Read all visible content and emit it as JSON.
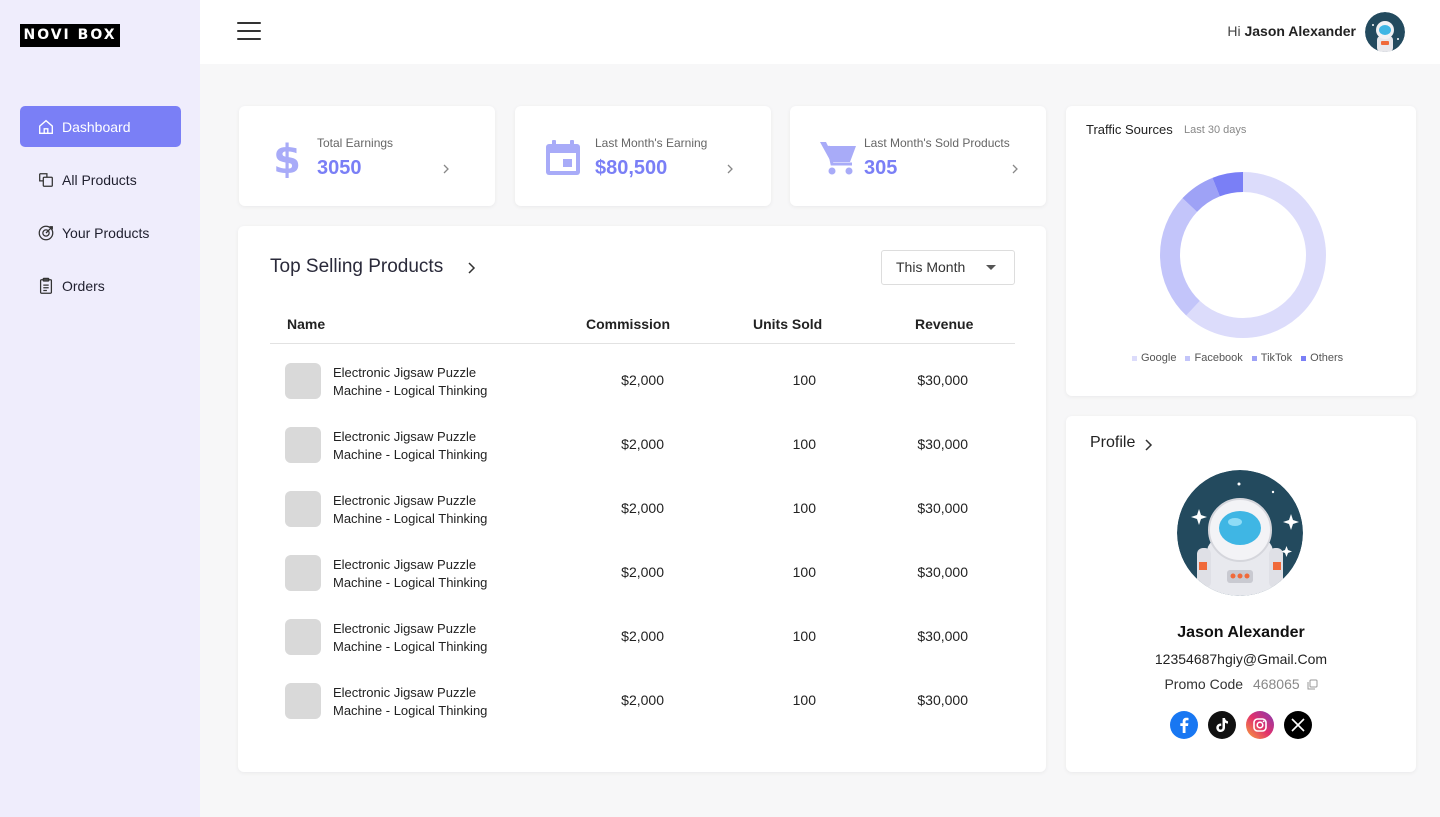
{
  "brand": {
    "logo_text": "NOVI BOX"
  },
  "sidebar": {
    "items": [
      {
        "label": "Dashboard",
        "icon": "home-icon",
        "active": true
      },
      {
        "label": "All Products",
        "icon": "products-icon"
      },
      {
        "label": "Your Products",
        "icon": "target-icon"
      },
      {
        "label": "Orders",
        "icon": "clipboard-icon"
      }
    ]
  },
  "header": {
    "greeting_prefix": "Hi",
    "user_name": "Jason Alexander"
  },
  "stats": [
    {
      "label": "Total Earnings",
      "value": "3050",
      "icon": "dollar-icon"
    },
    {
      "label": "Last Month's Earning",
      "value": "$80,500",
      "icon": "calendar-icon"
    },
    {
      "label": "Last Month's Sold Products",
      "value": "305",
      "icon": "cart-icon"
    }
  ],
  "top_selling": {
    "title": "Top Selling Products",
    "filter": "This Month",
    "columns": [
      "Name",
      "Commission",
      "Units Sold",
      "Revenue"
    ],
    "rows": [
      {
        "name_line1": "Electronic Jigsaw Puzzle",
        "name_line2": "Machine - Logical Thinking",
        "commission": "$2,000",
        "units": "100",
        "revenue": "$30,000"
      },
      {
        "name_line1": "Electronic Jigsaw Puzzle",
        "name_line2": "Machine - Logical Thinking",
        "commission": "$2,000",
        "units": "100",
        "revenue": "$30,000"
      },
      {
        "name_line1": "Electronic Jigsaw Puzzle",
        "name_line2": "Machine - Logical Thinking",
        "commission": "$2,000",
        "units": "100",
        "revenue": "$30,000"
      },
      {
        "name_line1": "Electronic Jigsaw Puzzle",
        "name_line2": "Machine - Logical Thinking",
        "commission": "$2,000",
        "units": "100",
        "revenue": "$30,000"
      },
      {
        "name_line1": "Electronic Jigsaw Puzzle",
        "name_line2": "Machine - Logical Thinking",
        "commission": "$2,000",
        "units": "100",
        "revenue": "$30,000"
      },
      {
        "name_line1": "Electronic Jigsaw Puzzle",
        "name_line2": "Machine - Logical Thinking",
        "commission": "$2,000",
        "units": "100",
        "revenue": "$30,000"
      }
    ]
  },
  "traffic": {
    "title": "Traffic Sources",
    "subtitle": "Last 30 days",
    "legend": [
      {
        "label": "Google",
        "color": "#dcdcfb"
      },
      {
        "label": "Facebook",
        "color": "#c3c5fa"
      },
      {
        "label": "TikTok",
        "color": "#9ea2f6"
      },
      {
        "label": "Others",
        "color": "#7a7ff6"
      }
    ]
  },
  "chart_data": {
    "type": "pie",
    "categories": [
      "Google",
      "Facebook",
      "TikTok",
      "Others"
    ],
    "values": [
      62,
      25,
      7,
      6
    ],
    "colors": [
      "#dcdcfb",
      "#c3c5fa",
      "#9ea2f6",
      "#7a7ff6"
    ]
  },
  "profile": {
    "title": "Profile",
    "name": "Jason Alexander",
    "email": "12354687hgiy@Gmail.Com",
    "promo_label": "Promo Code",
    "promo_code": "468065",
    "socials": [
      {
        "icon": "facebook-icon",
        "color": "#1877f2"
      },
      {
        "icon": "tiktok-icon",
        "color": "#111111"
      },
      {
        "icon": "instagram-icon",
        "color": "#d6249f"
      },
      {
        "icon": "x-icon",
        "color": "#000000"
      }
    ]
  }
}
